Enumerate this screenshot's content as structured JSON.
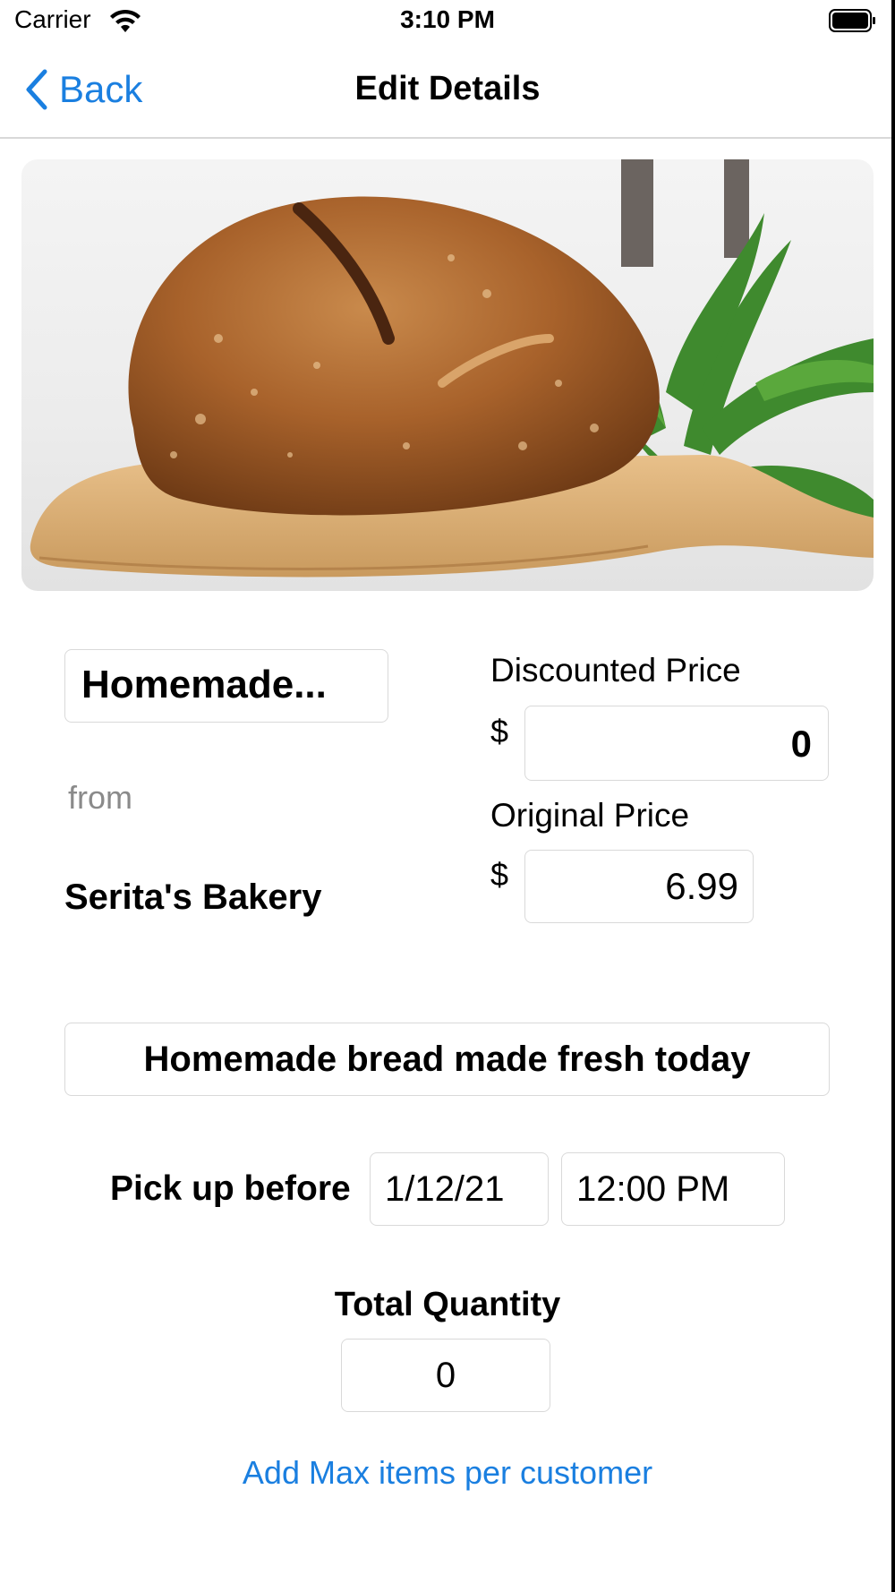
{
  "status_bar": {
    "carrier": "Carrier",
    "time": "3:10 PM"
  },
  "nav": {
    "back_label": "Back",
    "title": "Edit Details"
  },
  "item": {
    "name": "Homemade...",
    "from_label": "from",
    "store": "Serita's Bakery",
    "description": "Homemade bread made fresh today"
  },
  "pricing": {
    "discounted_label": "Discounted Price",
    "discounted_value": "0",
    "original_label": "Original Price",
    "original_value": "6.99",
    "currency": "$"
  },
  "pickup": {
    "label": "Pick up before",
    "date": "1/12/21",
    "time": "12:00 PM"
  },
  "quantity": {
    "label": "Total Quantity",
    "value": "0"
  },
  "add_max_link": "Add Max items per customer",
  "colors": {
    "accent": "#1a7fe0",
    "field_border": "#d9d9d9"
  }
}
